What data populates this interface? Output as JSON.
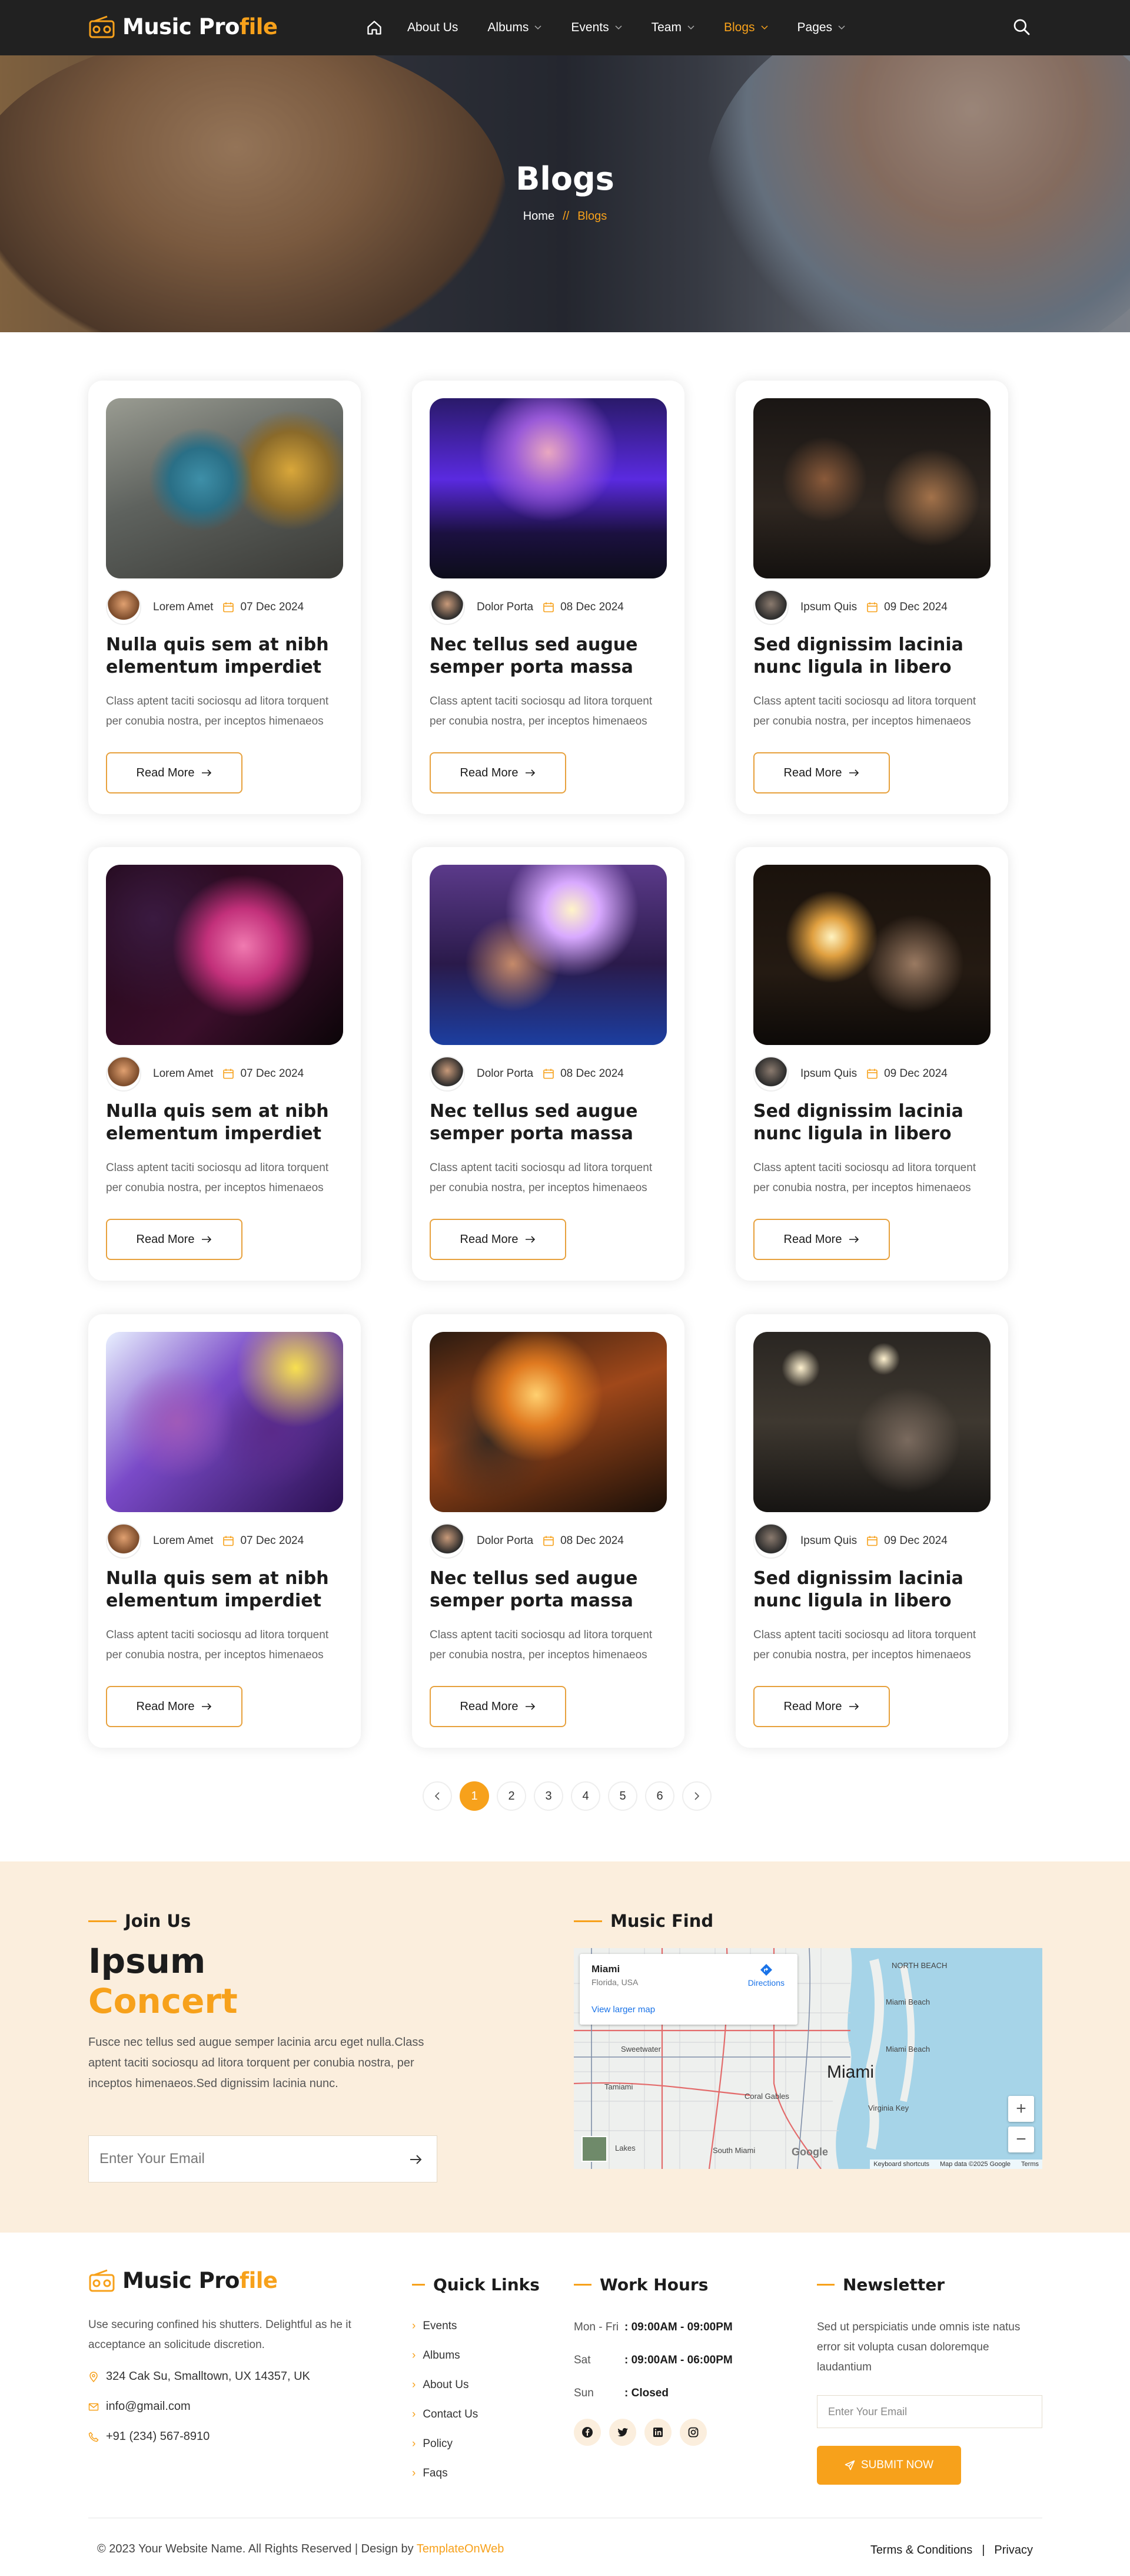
{
  "brand": {
    "name_prefix": "Music Pro",
    "name_accent": "file",
    "accent_color": "#f7a11b"
  },
  "nav": {
    "items": [
      {
        "label": "About Us",
        "dropdown": false,
        "active": false
      },
      {
        "label": "Albums",
        "dropdown": true,
        "active": false
      },
      {
        "label": "Events",
        "dropdown": true,
        "active": false
      },
      {
        "label": "Team",
        "dropdown": true,
        "active": false
      },
      {
        "label": "Blogs",
        "dropdown": true,
        "active": true
      },
      {
        "label": "Pages",
        "dropdown": true,
        "active": false
      }
    ],
    "home_icon": "home-icon",
    "search_icon": "search-icon"
  },
  "hero": {
    "title": "Blogs",
    "breadcrumb_home": "Home",
    "breadcrumb_sep": "//",
    "breadcrumb_current": "Blogs"
  },
  "posts": [
    {
      "author": "Lorem Amet",
      "date": "07 Dec 2024",
      "title": "Nulla quis sem at nibh elementum imperdiet",
      "excerpt": "Class aptent taciti sociosqu ad litora torquent per conubia nostra, per inceptos himenaeos",
      "button": "Read More",
      "image": "saxophone-street-musicians"
    },
    {
      "author": "Dolor Porta",
      "date": "08 Dec 2024",
      "title": "Nec tellus sed augue semper porta massa",
      "excerpt": "Class aptent taciti sociosqu ad litora torquent per conubia nostra, per inceptos himenaeos",
      "button": "Read More",
      "image": "dj-purple-lights"
    },
    {
      "author": "Ipsum Quis",
      "date": "09 Dec 2024",
      "title": "Sed dignissim lacinia nunc ligula in libero",
      "excerpt": "Class aptent taciti sociosqu ad litora torquent per conubia nostra, per inceptos himenaeos",
      "button": "Read More",
      "image": "string-orchestra"
    },
    {
      "author": "Lorem Amet",
      "date": "07 Dec 2024",
      "title": "Nulla quis sem at nibh elementum imperdiet",
      "excerpt": "Class aptent taciti sociosqu ad litora torquent per conubia nostra, per inceptos himenaeos",
      "button": "Read More",
      "image": "singer-pink-light"
    },
    {
      "author": "Dolor Porta",
      "date": "08 Dec 2024",
      "title": "Nec tellus sed augue semper porta massa",
      "excerpt": "Class aptent taciti sociosqu ad litora torquent per conubia nostra, per inceptos himenaeos",
      "button": "Read More",
      "image": "duo-guitar-concert"
    },
    {
      "author": "Ipsum Quis",
      "date": "09 Dec 2024",
      "title": "Sed dignissim lacinia nunc ligula in libero",
      "excerpt": "Class aptent taciti sociosqu ad litora torquent per conubia nostra, per inceptos himenaeos",
      "button": "Read More",
      "image": "saxophone-stage-light"
    },
    {
      "author": "Lorem Amet",
      "date": "07 Dec 2024",
      "title": "Nulla quis sem at nibh elementum imperdiet",
      "excerpt": "Class aptent taciti sociosqu ad litora torquent per conubia nostra, per inceptos himenaeos",
      "button": "Read More",
      "image": "singers-yellow-purple"
    },
    {
      "author": "Dolor Porta",
      "date": "08 Dec 2024",
      "title": "Nec tellus sed augue semper porta massa",
      "excerpt": "Class aptent taciti sociosqu ad litora torquent per conubia nostra, per inceptos himenaeos",
      "button": "Read More",
      "image": "drummer-orange-light"
    },
    {
      "author": "Ipsum Quis",
      "date": "09 Dec 2024",
      "title": "Sed dignissim lacinia nunc ligula in libero",
      "excerpt": "Class aptent taciti sociosqu ad litora torquent per conubia nostra, per inceptos himenaeos",
      "button": "Read More",
      "image": "band-stage-lights"
    }
  ],
  "pagination": {
    "pages": [
      "1",
      "2",
      "3",
      "4",
      "5",
      "6"
    ],
    "current": "1"
  },
  "join": {
    "heading": "Join Us",
    "title_line1": "Ipsum",
    "title_line2": "Concert",
    "description": "Fusce nec tellus sed augue semper lacinia arcu eget nulla.Class aptent taciti sociosqu ad litora torquent per conubia nostra, per inceptos himenaeos.Sed dignissim lacinia nunc.",
    "email_placeholder": "Enter Your Email"
  },
  "map": {
    "heading": "Music Find",
    "place": "Miami",
    "region": "Florida, USA",
    "directions": "Directions",
    "view_larger": "View larger map",
    "city_label": "Miami",
    "labels": [
      "NORTH BEACH",
      "Miami Beach",
      "Miami Beach",
      "Sweetwater",
      "Tamiami",
      "Coral Gables",
      "Virginia Key",
      "South Miami",
      "Lakes"
    ],
    "attribution": [
      "Keyboard shortcuts",
      "Map data ©2025 Google",
      "Terms"
    ],
    "google": "Google"
  },
  "footer": {
    "about": "Use securing confined his shutters. Delightful as he it acceptance an solicitude discretion.",
    "address": "324 Cak Su, Smalltown, UX 14357, UK",
    "email": "info@gmail.com",
    "phone": "+91 (234) 567-8910",
    "quick_links_heading": "Quick Links",
    "quick_links": [
      "Events",
      "Albums",
      "About Us",
      "Contact Us",
      "Policy",
      "Faqs"
    ],
    "work_hours_heading": "Work Hours",
    "work_hours": [
      {
        "day": "Mon - Fri",
        "time": ": 09:00AM - 09:00PM"
      },
      {
        "day": "Sat",
        "time": ": 09:00AM - 06:00PM"
      },
      {
        "day": "Sun",
        "time": ": Closed"
      }
    ],
    "socials": [
      "facebook-icon",
      "twitter-icon",
      "linkedin-icon",
      "instagram-icon"
    ],
    "newsletter_heading": "Newsletter",
    "newsletter_text": "Sed ut perspiciatis unde omnis iste natus error sit volupta cusan doloremque laudantium",
    "newsletter_placeholder": "Enter Your Email",
    "newsletter_button": "SUBMIT NOW",
    "copyright_prefix": "© 2023 Your Website Name. All Rights Reserved | Design by ",
    "copyright_link": "TemplateOnWeb",
    "terms": "Terms & Conditions",
    "legal_sep": "|",
    "privacy": "Privacy"
  }
}
